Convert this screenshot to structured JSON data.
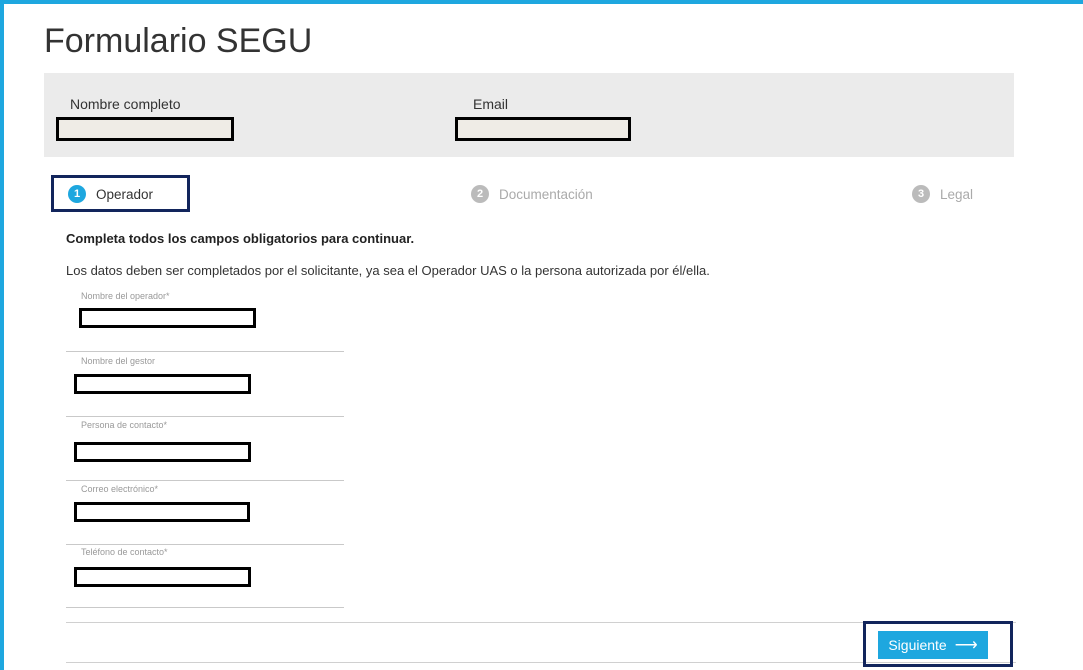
{
  "form": {
    "title": "Formulario SEGU"
  },
  "user_band": {
    "name_label": "Nombre completo",
    "name_value": "",
    "email_label": "Email",
    "email_value": ""
  },
  "steps": [
    {
      "number": "1",
      "label": "Operador",
      "state": "active"
    },
    {
      "number": "2",
      "label": "Documentación",
      "state": "inactive"
    },
    {
      "number": "3",
      "label": "Legal",
      "state": "inactive"
    }
  ],
  "intro": {
    "bold": "Completa todos los campos obligatorios para continuar.",
    "text": "Los datos deben ser completados por el solicitante, ya sea el Operador UAS o la persona autorizada por él/ella."
  },
  "fields": [
    {
      "label": "Nombre del operador*",
      "value": ""
    },
    {
      "label": "Nombre del gestor",
      "value": ""
    },
    {
      "label": "Persona de contacto*",
      "value": ""
    },
    {
      "label": "Correo electrónico*",
      "value": ""
    },
    {
      "label": "Teléfono de contacto*",
      "value": ""
    }
  ],
  "actions": {
    "next_label": "Siguiente",
    "next_icon": "long-arrow-right-icon"
  },
  "colors": {
    "accent": "#1ea7df",
    "highlight_border": "#12255c",
    "band_bg": "#ebebeb"
  }
}
